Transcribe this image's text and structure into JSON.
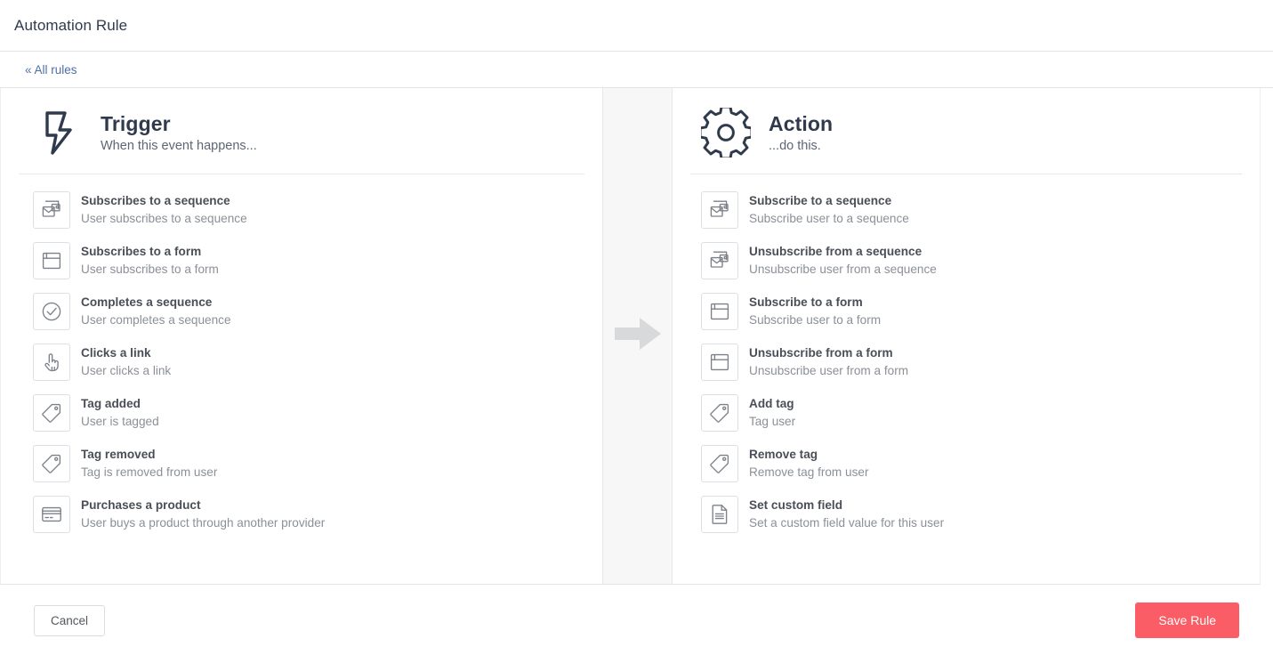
{
  "window": {
    "title": "Automation Rule"
  },
  "breadcrumb": {
    "back_label": "« All rules",
    "link_color": "#4d6fa8"
  },
  "trigger_panel": {
    "icon": "lightning-bolt-icon",
    "title": "Trigger",
    "subtitle": "When this event happens...",
    "options": [
      {
        "icon": "envelope-sequence-icon",
        "title": "Subscribes to a sequence",
        "desc": "User subscribes to a sequence"
      },
      {
        "icon": "form-window-icon",
        "title": "Subscribes to a form",
        "desc": "User subscribes to a form"
      },
      {
        "icon": "check-circle-icon",
        "title": "Completes a sequence",
        "desc": "User completes a sequence"
      },
      {
        "icon": "pointing-hand-icon",
        "title": "Clicks a link",
        "desc": "User clicks a link"
      },
      {
        "icon": "tag-icon",
        "title": "Tag added",
        "desc": "User is tagged"
      },
      {
        "icon": "tag-icon",
        "title": "Tag removed",
        "desc": "Tag is removed from user"
      },
      {
        "icon": "credit-card-icon",
        "title": "Purchases a product",
        "desc": "User buys a product through another provider"
      }
    ]
  },
  "connector": {
    "icon": "arrow-right-icon",
    "color": "#d8d9db"
  },
  "action_panel": {
    "icon": "gear-icon",
    "title": "Action",
    "subtitle": "...do this.",
    "options": [
      {
        "icon": "envelope-sequence-icon",
        "title": "Subscribe to a sequence",
        "desc": "Subscribe user to a sequence"
      },
      {
        "icon": "envelope-sequence-icon",
        "title": "Unsubscribe from a sequence",
        "desc": "Unsubscribe user from a sequence"
      },
      {
        "icon": "form-window-icon",
        "title": "Subscribe to a form",
        "desc": "Subscribe user to a form"
      },
      {
        "icon": "form-window-icon",
        "title": "Unsubscribe from a form",
        "desc": "Unsubscribe user from a form"
      },
      {
        "icon": "tag-icon",
        "title": "Add tag",
        "desc": "Tag user"
      },
      {
        "icon": "tag-icon",
        "title": "Remove tag",
        "desc": "Remove tag from user"
      },
      {
        "icon": "document-icon",
        "title": "Set custom field",
        "desc": "Set a custom field value for this user"
      }
    ]
  },
  "footer": {
    "cancel_label": "Cancel",
    "save_label": "Save Rule",
    "save_color": "#fb5d67"
  }
}
